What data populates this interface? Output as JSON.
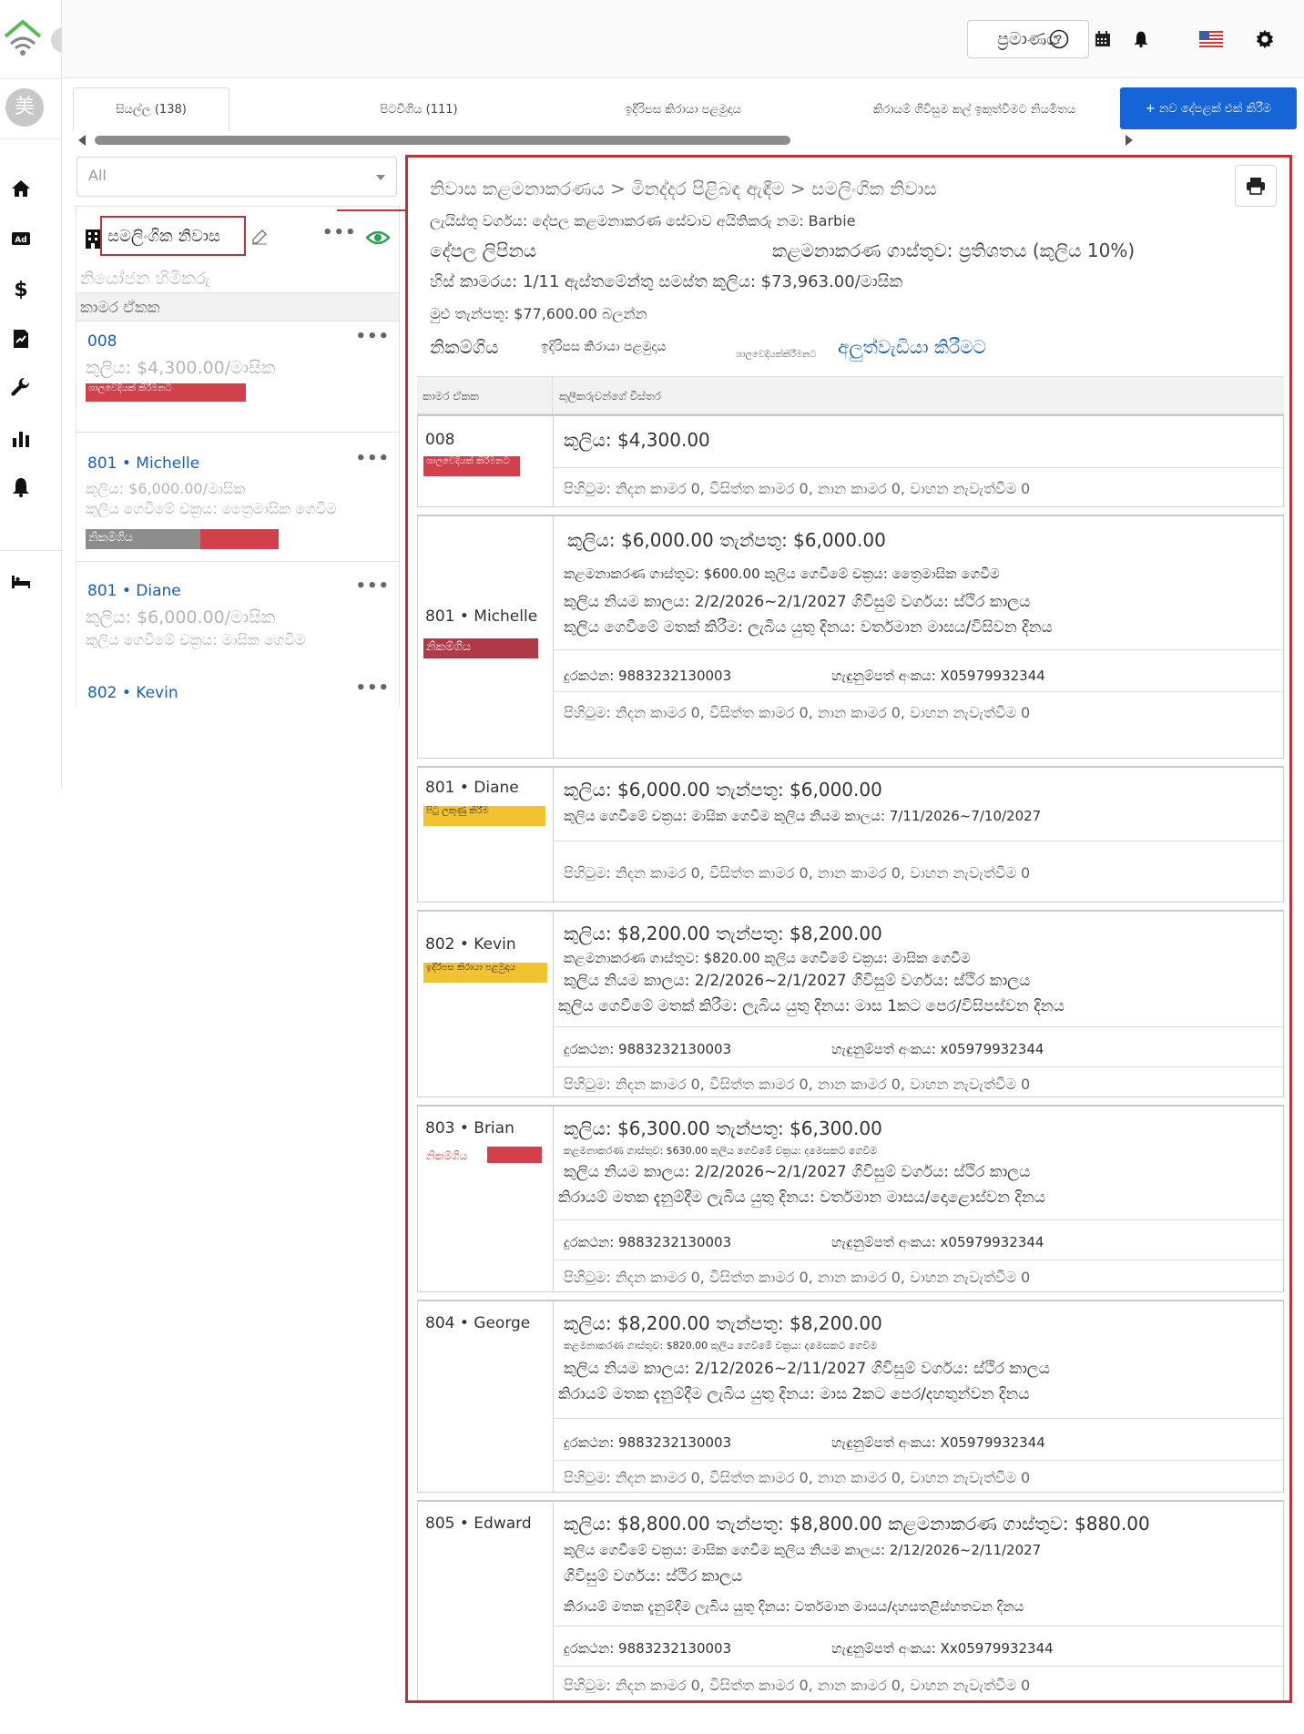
{
  "rail": {
    "avatar_text": "美",
    "icons": [
      "home-icon",
      "ad-icon",
      "dollar-icon",
      "contract-icon",
      "wrench-icon",
      "bar-chart-icon",
      "bell-icon",
      "bed-icon"
    ]
  },
  "topbar": {
    "language_label": "ප්‍රමාණය",
    "icons": [
      "help-icon",
      "calendar-icon",
      "bell-icon",
      "us-flag-icon",
      "gear-icon"
    ]
  },
  "tabs": [
    {
      "label": "සියල්ල (138)",
      "active": true
    },
    {
      "label": "පිටවීගිය (111)",
      "active": false
    },
    {
      "label": "ඉදිරිපස කිරායා පළමුදාය",
      "active": false
    },
    {
      "label": "කිරායම් ගිවිසුම කල් ඉකුත්වීමට නියමිතය",
      "active": false
    }
  ],
  "new_button_label": "+ නව දේපළක් එක් කිරීම",
  "filter": {
    "value": "All"
  },
  "property": {
    "name": "සමලිංගික නිවාස",
    "subtitle": "නියෝජන හිමිකරු",
    "unit_header": "කාමර ඒකක"
  },
  "list_items": [
    {
      "name": "008",
      "line1": "කුලිය: $4,300.00/මාසික",
      "line2": "",
      "tag": "ශාලවෙදියක් කිරීමනට"
    },
    {
      "name": "801 • Michelle",
      "line1": "කුලිය: $6,000.00/මාසික",
      "line2": "කුලිය ගෙවීමේ චක්‍රය: ත්‍රෛමාසික ගෙවීම",
      "tag": "නිකම්ගිය"
    },
    {
      "name": "801 • Diane",
      "line1": "කුලිය: $6,000.00/මාසික",
      "line2": "කුලිය ගෙවීමේ චක්‍රය: මාසික ගෙවීම",
      "tag": ""
    },
    {
      "name": "802 • Kevin",
      "line1": "",
      "line2": "",
      "tag": ""
    }
  ],
  "detail": {
    "breadcrumb": "නිවාස කළමනාකරණය > මිනද්දර පිළිබඳ ඇඳීම > සමලිංගික නිවාස",
    "line_type_owner": "ලැයිස්තු වර්ගය: දේපල කළමනාකරණ සේවාව    අයිතිකරු නම: Barbie",
    "addr_label": "දේපල ලිපිනය",
    "mgmt_fee": "කළමනාකරණ ගාස්තුව: ප්‍රතිශතය (කුලිය 10%)",
    "vacancy_total": "හිස් කාමරය: 1/11 ඇස්තමේන්තු සමස්ත කුලිය: $73,963.00/මාසික",
    "deposit_total": "මුළු තැන්පතු: $77,600.00 බලන්න",
    "status_label": "නිකම්ගිය",
    "status_mid": "ඉදිරිපස කිරායා පළමුදාය",
    "status_tiny": "ශාලවෙදියක්කිරීමනට",
    "renew_link": "අලුත්වැඩියා කිරීමට",
    "col_unit": "කාමර ඒකක",
    "col_tenant": "කුලීකරුවන්ගේ විස්තර"
  },
  "rows": [
    {
      "unit": "008",
      "tag": "ශාලවෙදියක් කිරීමනට",
      "tag_style": "red",
      "rent": "කුලිය: $4,300.00",
      "amenities": "පිහිටුම: නිදන කාමර 0, විසිත්ත කාමර 0, නාන කාමර 0, වාහන නැවැත්වීම 0"
    },
    {
      "unit": "801 • Michelle",
      "tag": "නිකම්ගිය",
      "tag_style": "maroon",
      "rent": "කුලිය: $6,000.00      තැන්පතු: $6,000.00",
      "l2": "කළමනාකරණ ගාස්තුව: $600.00 කුලිය ගෙවීමේ චක්‍රය: ත්‍රෛමාසික ගෙවීම",
      "l3": "කුලිය නියම කාලය: 2/2/2026~2/1/2027 ගිවිසුම් වර්ගය: ස්ථිර කාලය",
      "l4": "කුලිය ගෙවීමේ මතක් කිරීම: ලැබිය යුතු දිනය: වර්තමාන මාසය/විසිවන දිනය",
      "phone": "දුරකථන: 9883232130003",
      "id": "හැඳුනුම්පත් අංකය: X05979932344",
      "amenities": "පිහිටුම: නිදන කාමර 0, විසිත්ත කාමර 0, නාන කාමර 0, වාහන නැවැත්වීම 0"
    },
    {
      "unit": "801 • Diane",
      "tag": "පිටු ලකුණු කිරීම",
      "tag_style": "yellow",
      "rent": "කුලිය: $6,000.00      තැන්පතු: $6,000.00",
      "l2": "කුලිය ගෙවීමේ චක්‍රය: මාසික ගෙවීම කුලිය නියම කාලය: 7/11/2026~7/10/2027",
      "amenities": "පිහිටුම: නිදන කාමර 0, විසිත්ත කාමර 0, නාන කාමර 0, වාහන නැවැත්වීම 0"
    },
    {
      "unit": "802 • Kevin",
      "tag": "ඉදිරිපස කිරායා පළමුදාය",
      "tag_style": "yellow",
      "rent": "කුලිය: $8,200.00      තැන්පතු: $8,200.00",
      "l2": "කළමනාකරණ ගාස්තුව: $820.00 කුලිය ගෙවීමේ චක්‍රය: මාසික ගෙවීම",
      "l3": "කුලිය නියම කාලය: 2/2/2026~2/1/2027 ගිවිසුම් වර්ගය: ස්ථිර කාලය",
      "l4": "කුලිය ගෙවීමේ මතක් කිරීම: ලැබිය යුතු දිනය: මාස 1කට පෙර/විසිපස්වන දිනය",
      "phone": "දුරකථන: 9883232130003",
      "id": "හැඳුනුම්පත් අංකය: x05979932344",
      "amenities": "පිහිටුම: නිදන කාමර 0, විසිත්ත කාමර 0, නාන කාමර 0, වාහන නැවැත්වීම 0"
    },
    {
      "unit": "803 • Brian",
      "tag": "නිකම්ගිය",
      "tag_style": "red-text",
      "rent": "කුලිය: $6,300.00      තැන්පතු: $6,300.00",
      "l2": "කළමනාකරණ ගාස්තුව: $630.00          කුලිය ගෙවීමේ චක්‍රය: දමෙසකට ගෙවීම",
      "l3": "කුලිය නියම කාලය: 2/2/2026~2/1/2027 ගිවිසුම් වර්ගය: ස්ථිර කාලය",
      "l4": "කිරායම් මතක දැනුම්දීම    ලැබිය යුතු දිනය: වර්තමාන මාසය/දොළොස්වන දිනය",
      "phone": "දුරකථන: 9883232130003",
      "id": "හැඳුනුම්පත් අංකය: x05979932344",
      "amenities": "පිහිටුම: නිදන කාමර 0, විසිත්ත කාමර 0, නාන කාමර 0, වාහන නැවැත්වීම 0"
    },
    {
      "unit": "804 • George",
      "tag": "",
      "tag_style": "",
      "rent": "කුලිය: $8,200.00      තැන්පතු: $8,200.00",
      "l2": "කළමනාකරණ ගාස්තුව: $820.00          කුලිය ගෙවීමේ චක්‍රය: දමෙසකට ගෙවීම",
      "l3": "කුලිය නියම කාලය: 2/12/2026~2/11/2027 ගිවිසුම් වර්ගය: ස්ථිර කාලය",
      "l4": "කිරායම් මතක දැනුම්දීම ලැබිය යුතු දිනය: මාස 2කට පෙර/දහතුන්වන දිනය",
      "phone": "දුරකථන: 9883232130003",
      "id": "හැඳුනුම්පත් අංකය: X05979932344",
      "amenities": "පිහිටුම: නිදන කාමර 0, විසිත්ත කාමර 0, නාන කාමර 0, වාහන නැවැත්වීම 0"
    },
    {
      "unit": "805 • Edward",
      "tag": "",
      "tag_style": "",
      "rent": "කුලිය: $8,800.00      තැන්පතු: $8,800.00 කළමනාකරණ ගාස්තුව: $880.00",
      "l2": "කුලිය ගෙවීමේ චක්‍රය: මාසික ගෙවීම කුලිය නියම කාලය: 2/12/2026~2/11/2027",
      "l3": "ගිවිසුම් වර්ගය: ස්ථිර කාලය",
      "l4": "කිරායම් මතක දැනුම්දීම      ලැබිය යුතු දිනය: වර්තමාන මාසය/දහසතළිස්හතවන දිනය",
      "phone": "දුරකථන: 9883232130003",
      "id": "හැඳුනුම්පත් අංකය: Xx05979932344",
      "amenities": "පිහිටුම: නිදන කාමර 0, විසිත්ත කාමර 0, නාන කාමර 0, වාහන නැවැත්වීම 0"
    }
  ],
  "colors": {
    "accent": "#1565d8",
    "highlight_border": "#c0313a",
    "tag_red": "#d2404c",
    "tag_yellow": "#f2c230",
    "logo_green": "#5cb85c",
    "eye_green": "#2e9e4f"
  }
}
